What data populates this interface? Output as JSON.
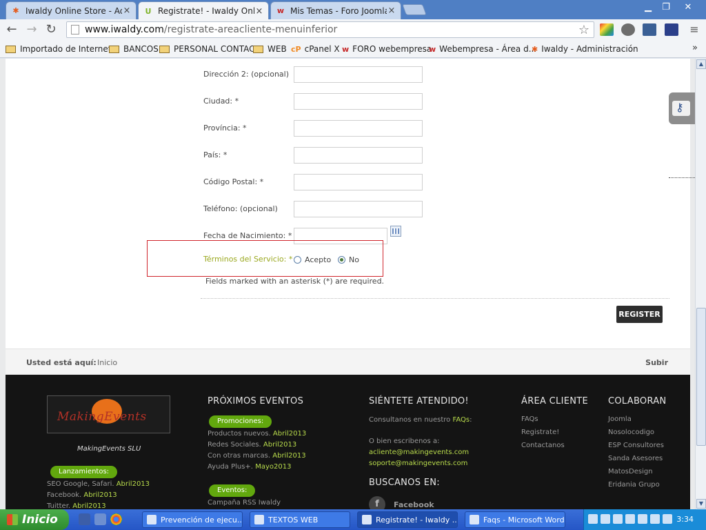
{
  "browser": {
    "tabs": [
      {
        "title": "Iwaldy Online Store - Admin",
        "favicon": "joomla-icon",
        "active": false
      },
      {
        "title": "Registrate! - Iwaldy Online S",
        "favicon": "iwaldy-icon",
        "active": true
      },
      {
        "title": "Mis Temas - Foro Joomla! - S",
        "favicon": "webempresa-icon",
        "active": false
      }
    ],
    "url_host": "www.iwaldy.com",
    "url_path": "/registrate-areacliente-menuinferior",
    "bookmarks": [
      {
        "label": "Importado de Internet...",
        "type": "folder"
      },
      {
        "label": "BANCOS",
        "type": "folder"
      },
      {
        "label": "PERSONAL CONTACT",
        "type": "folder"
      },
      {
        "label": "WEB",
        "type": "folder"
      },
      {
        "label": "cPanel X",
        "type": "cpanel"
      },
      {
        "label": "FORO webempresa",
        "type": "webempresa"
      },
      {
        "label": "Webempresa - Área d...",
        "type": "webempresa"
      },
      {
        "label": "Iwaldy - Administración",
        "type": "joomla"
      }
    ],
    "bookmarks_more": "»"
  },
  "form": {
    "fields": [
      {
        "label": "Dirección 2: (opcional)",
        "value": ""
      },
      {
        "label": "Ciudad: *",
        "value": ""
      },
      {
        "label": "Província: *",
        "value": ""
      },
      {
        "label": "País: *",
        "value": ""
      },
      {
        "label": "Código Postal: *",
        "value": ""
      },
      {
        "label": "Teléfono: (opcional)",
        "value": ""
      },
      {
        "label": "Fecha de Nacimiento: *",
        "value": ""
      }
    ],
    "terms_label": "Términos del Servicio: *",
    "terms_options": [
      {
        "label": "Acepto",
        "selected": false
      },
      {
        "label": "No",
        "selected": true
      }
    ],
    "required_note": "Fields marked with an asterisk (*) are required.",
    "register_label": "REGISTER"
  },
  "breadcrumb": {
    "label": "Usted está aquí:",
    "home": "Inicio",
    "back_to_top": "Subir"
  },
  "footer": {
    "company": "MakingEvents SLU",
    "logo_text": "MakingEvents",
    "launches": {
      "pill": "Lanzamientos:",
      "items": [
        {
          "text": "SEO Google, Safari.",
          "date": "Abril2013"
        },
        {
          "text": "Facebook.",
          "date": "Abril2013"
        },
        {
          "text": "Tuitter.",
          "date": "Abril2013"
        }
      ]
    },
    "events": {
      "title": "PRÓXIMOS EVENTOS",
      "promo_pill": "Promociones:",
      "promos": [
        {
          "text": "Productos nuevos.",
          "date": "Abril2013"
        },
        {
          "text": "Redes Sociales.",
          "date": "Abril2013"
        },
        {
          "text": "Con otras marcas.",
          "date": "Abril2013"
        },
        {
          "text": "Ayuda Plus+.",
          "date": "Mayo2013"
        }
      ],
      "events_pill": "Eventos:",
      "events_items": [
        {
          "text": "Campaña RSS Iwaldy"
        }
      ]
    },
    "attended": {
      "title": "SIÉNTETE ATENDIDO!",
      "consult": "Consultanos en nuestro",
      "faqs": "FAQs",
      "write": "O bien escribenos a:",
      "email1": "acliente@makingevents.com",
      "email2": "soporte@makingevents.com",
      "find_title": "BUSCANOS EN:",
      "facebook": "Facebook"
    },
    "client": {
      "title": "ÁREA CLIENTE",
      "links": [
        "FAQs",
        "Registrate!",
        "Contactanos"
      ]
    },
    "collab": {
      "title": "COLABORAN",
      "links": [
        "Joomla",
        "Nosolocodigo",
        "ESP Consultores",
        "Sanda Asesores",
        "MatosDesign",
        "Eridania Grupo"
      ]
    }
  },
  "taskbar": {
    "start_label": "Inicio",
    "tasks": [
      {
        "label": "Prevención de ejecu...",
        "active": false
      },
      {
        "label": "TEXTOS WEB",
        "active": false
      },
      {
        "label": "Registrate! - Iwaldy ...",
        "active": true
      },
      {
        "label": "Faqs - Microsoft Word",
        "active": false
      }
    ],
    "clock": "3:34"
  }
}
